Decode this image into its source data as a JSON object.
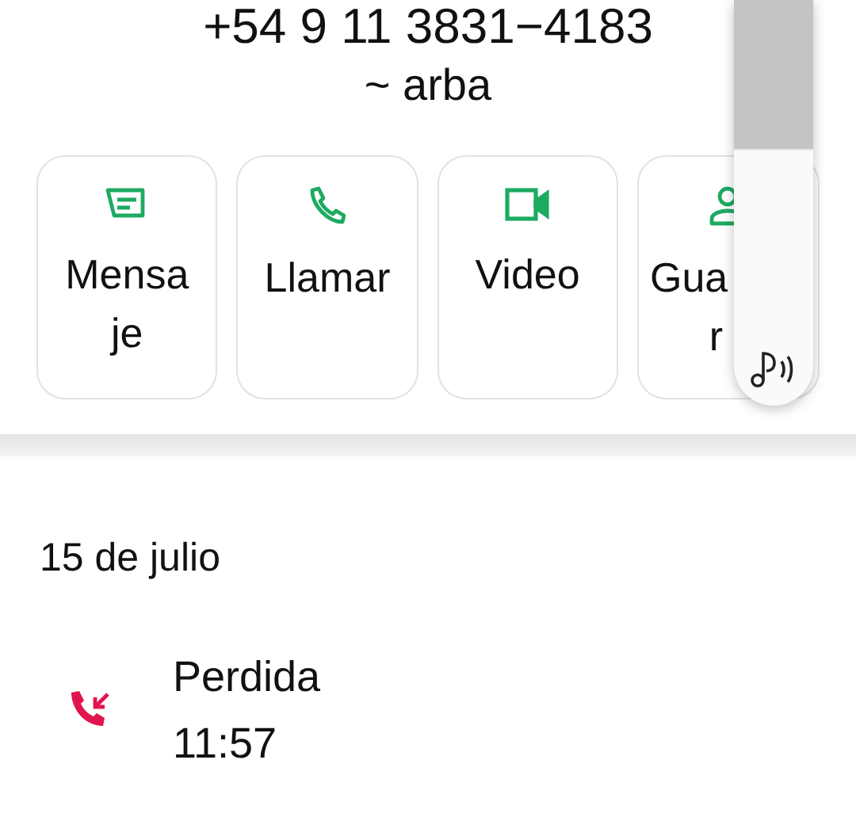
{
  "contact": {
    "phone": "+54 9 11 3831−4183",
    "name": "~ arba"
  },
  "actions": [
    {
      "kind": "message",
      "lines": [
        "Mensa",
        "je"
      ],
      "covered": false
    },
    {
      "kind": "call",
      "lines": [
        "Llamar"
      ],
      "covered": false
    },
    {
      "kind": "video",
      "lines": [
        "Video"
      ],
      "covered": false
    },
    {
      "kind": "save",
      "lines": [
        "Gua",
        "r"
      ],
      "covered": true
    }
  ],
  "history": {
    "date": "15 de julio",
    "calls": [
      {
        "kind": "missed",
        "status": "Perdida",
        "time": "11:57"
      }
    ]
  },
  "volume": {
    "level": 0.63
  }
}
